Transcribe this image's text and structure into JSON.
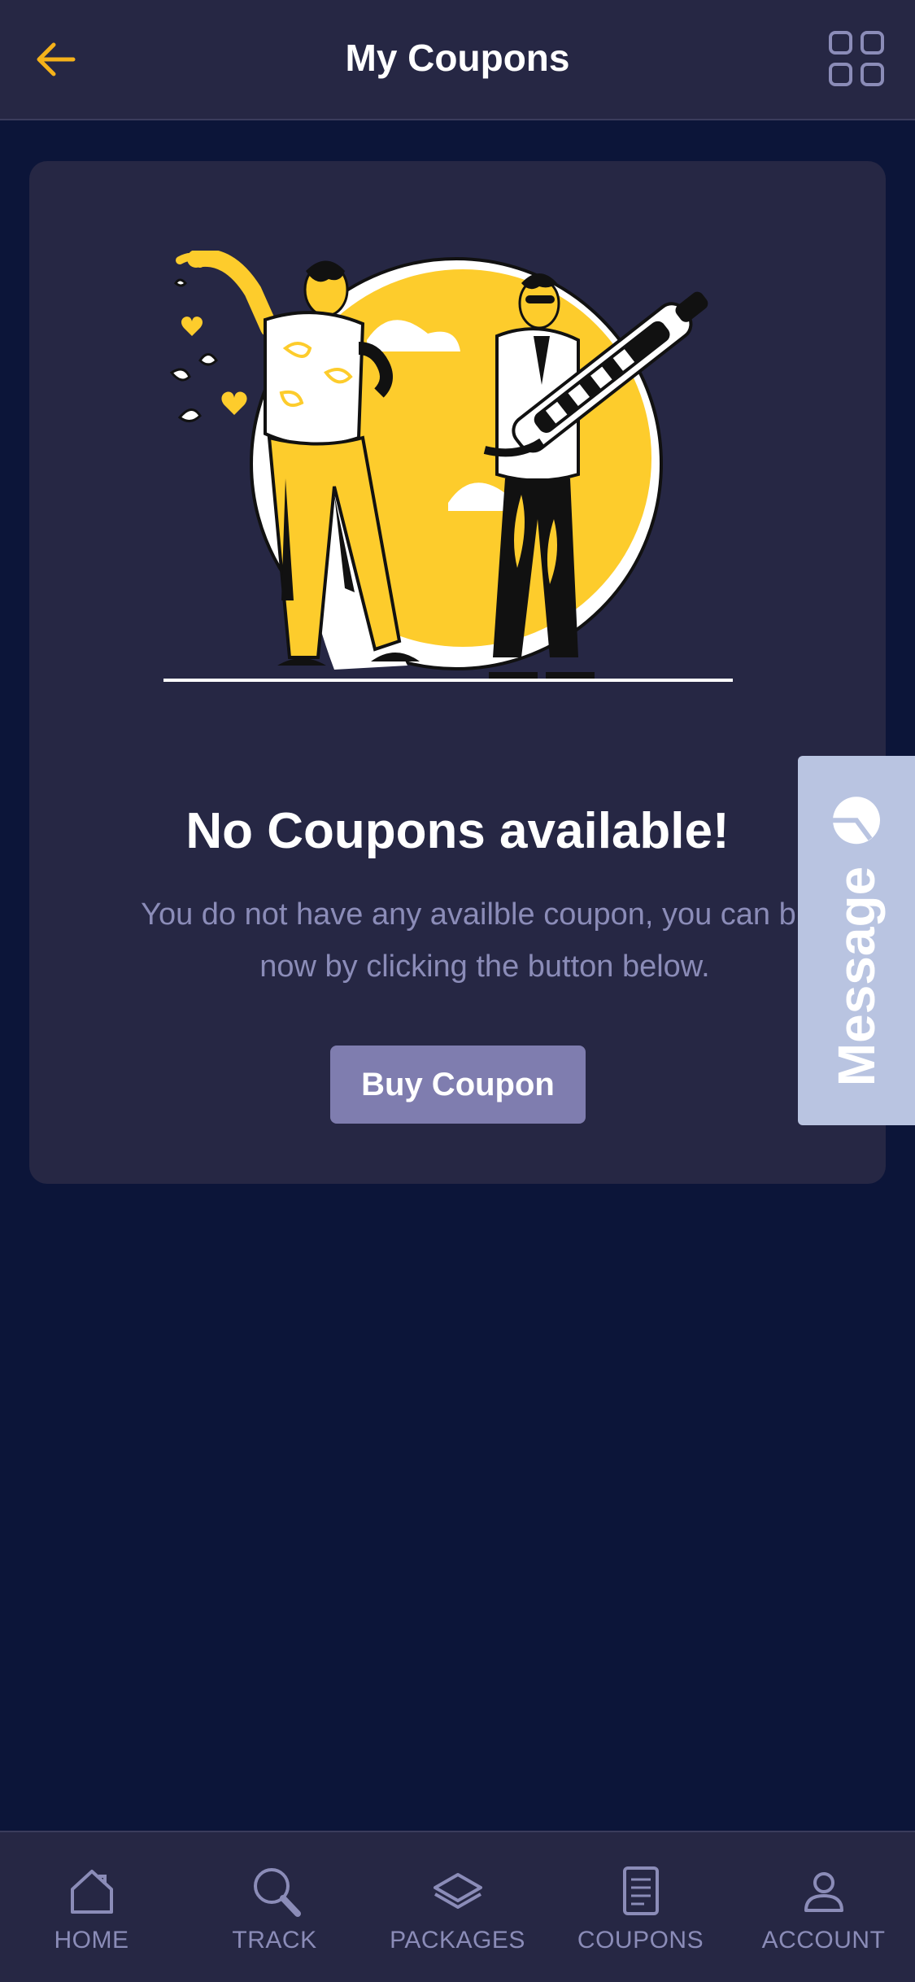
{
  "header": {
    "title": "My Coupons",
    "back_icon": "arrow-left-icon",
    "menu_icon": "grid-icon"
  },
  "empty_state": {
    "illustration": "people-celebrating-illustration",
    "title": "No Coupons available!",
    "description_line1": "You do not have any availble coupon, you can buy",
    "description_line2": "now by clicking the button below.",
    "button_label": "Buy Coupon"
  },
  "message_tab": {
    "label": "Message",
    "icon": "chat-bubble-icon"
  },
  "bottom_nav": {
    "items": [
      {
        "label": "HOME",
        "icon": "home-icon"
      },
      {
        "label": "TRACK",
        "icon": "search-icon"
      },
      {
        "label": "PACKAGES",
        "icon": "layers-icon"
      },
      {
        "label": "COUPONS",
        "icon": "document-icon"
      },
      {
        "label": "ACCOUNT",
        "icon": "user-icon"
      }
    ]
  },
  "colors": {
    "background": "#0c1539",
    "surface": "#262744",
    "accent": "#f5b21a",
    "muted_text": "#8b8cb8",
    "button": "#7f7daf",
    "message_tab": "#b9c4e1",
    "illustration_yellow": "#fdcc2c"
  }
}
